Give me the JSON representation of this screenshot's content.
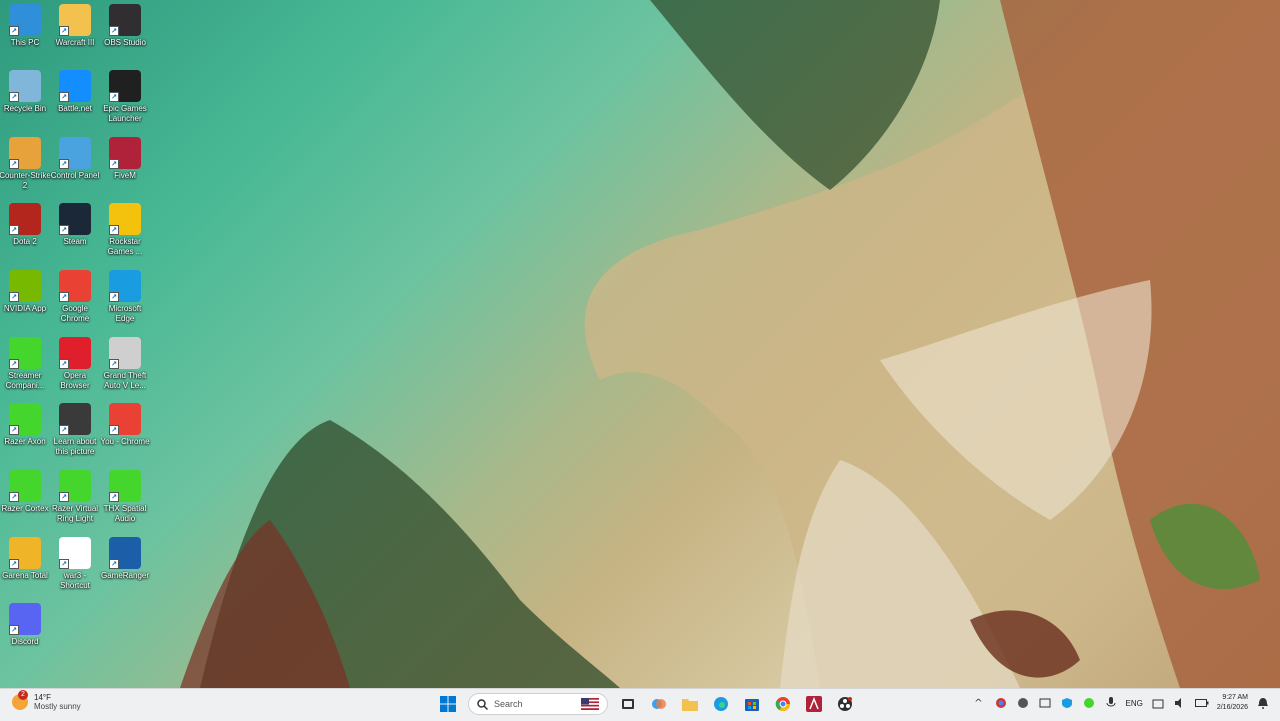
{
  "desktop": {
    "icons": [
      {
        "label": "This PC",
        "icon": "this-pc-icon",
        "color": "#2f8fd8"
      },
      {
        "label": "Warcraft III",
        "icon": "folder-icon",
        "color": "#f2c14e"
      },
      {
        "label": "OBS Studio",
        "icon": "obs-icon",
        "color": "#302e31"
      },
      {
        "label": "Recycle Bin",
        "icon": "recycle-bin-icon",
        "color": "#7fb6d9"
      },
      {
        "label": "Battle.net",
        "icon": "battlenet-icon",
        "color": "#148eff"
      },
      {
        "label": "Epic Games Launcher",
        "icon": "epic-games-icon",
        "color": "#202020"
      },
      {
        "label": "Counter-Strike 2",
        "icon": "counter-strike-icon",
        "color": "#e8a23b"
      },
      {
        "label": "Control Panel",
        "icon": "control-panel-icon",
        "color": "#4aa3df"
      },
      {
        "label": "FiveM",
        "icon": "fivem-icon",
        "color": "#b0213a"
      },
      {
        "label": "Dota 2",
        "icon": "dota-icon",
        "color": "#b3261e"
      },
      {
        "label": "Steam",
        "icon": "steam-icon",
        "color": "#1b2838"
      },
      {
        "label": "Rockstar Games ...",
        "icon": "rockstar-icon",
        "color": "#f4c20d"
      },
      {
        "label": "NVIDIA App",
        "icon": "nvidia-icon",
        "color": "#76b900"
      },
      {
        "label": "Google Chrome",
        "icon": "chrome-icon",
        "color": "#e94235"
      },
      {
        "label": "Microsoft Edge",
        "icon": "edge-icon",
        "color": "#1a9de0"
      },
      {
        "label": "Streamer Compani...",
        "icon": "razer-streamer-icon",
        "color": "#44d62c"
      },
      {
        "label": "Opera Browser",
        "icon": "opera-icon",
        "color": "#e01f2c"
      },
      {
        "label": "Grand Theft Auto V Le...",
        "icon": "gta-icon",
        "color": "#cfcfcf"
      },
      {
        "label": "Razer Axon",
        "icon": "razer-axon-icon",
        "color": "#44d62c"
      },
      {
        "label": "Learn about this picture",
        "icon": "learn-picture-icon",
        "color": "#3a3a3a"
      },
      {
        "label": "You - Chrome",
        "icon": "chrome-profile-icon",
        "color": "#e94235"
      },
      {
        "label": "Razer Cortex",
        "icon": "razer-cortex-icon",
        "color": "#44d62c"
      },
      {
        "label": "Razer Virtual Ring Light",
        "icon": "razer-ring-light-icon",
        "color": "#44d62c"
      },
      {
        "label": "THX Spatial Audio",
        "icon": "thx-icon",
        "color": "#44d62c"
      },
      {
        "label": "Garena Total",
        "icon": "garena-icon",
        "color": "#f0b429"
      },
      {
        "label": "war3 - Shortcut",
        "icon": "war3-shortcut-icon",
        "color": "#ffffff"
      },
      {
        "label": "GameRanger",
        "icon": "gameranger-icon",
        "color": "#1c5fa8"
      },
      {
        "label": "Discord",
        "icon": "discord-icon",
        "color": "#5865f2"
      }
    ]
  },
  "taskbar": {
    "weather": {
      "temp": "14°F",
      "condition": "Mostly sunny",
      "badge": "2"
    },
    "search_placeholder": "Search",
    "language": "ENG",
    "time": "9:27 AM",
    "date": "2/16/2026"
  }
}
